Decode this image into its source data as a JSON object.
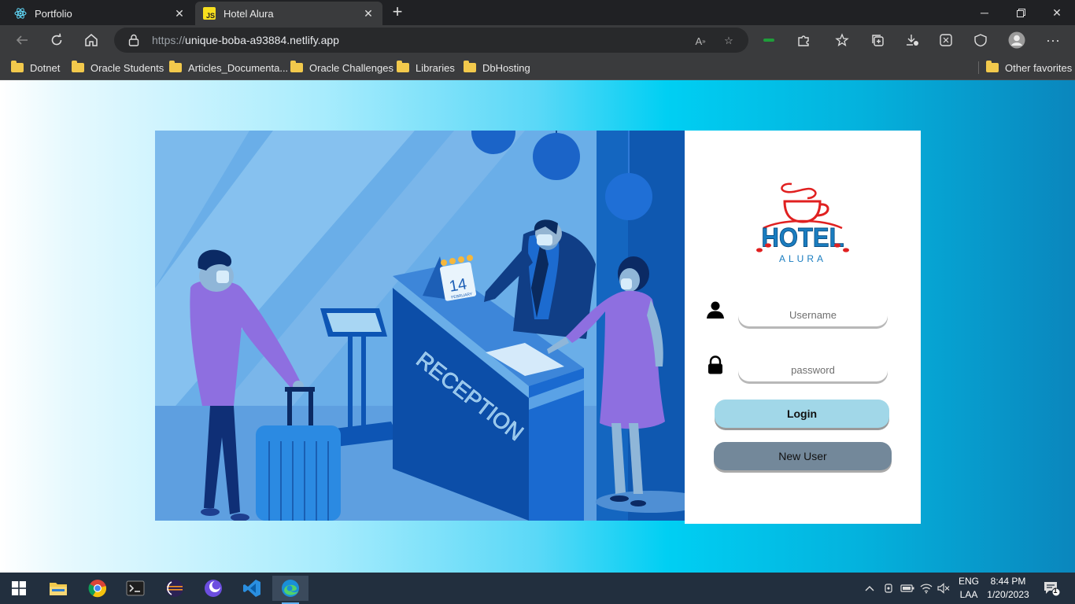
{
  "browser": {
    "tabs": [
      {
        "title": "Portfolio",
        "icon": "react-icon"
      },
      {
        "title": "Hotel Alura",
        "icon": "js-icon",
        "icon_text": "JS"
      }
    ],
    "url_prefix": "https://",
    "url_host": "unique-boba-a93884.netlify.app"
  },
  "bookmarks": [
    "Dotnet",
    "Oracle Students",
    "Articles_Documenta...",
    "Oracle Challenges",
    "Libraries",
    "DbHosting"
  ],
  "other_favorites": "Other favorites",
  "hero": {
    "sign_text": "RECEPTION",
    "calendar_day": "14",
    "calendar_month": "FEBRUARY"
  },
  "login": {
    "logo_line1": "HOTEL",
    "logo_line2": "ALURA",
    "username_placeholder": "Username",
    "password_placeholder": "password",
    "login_label": "Login",
    "new_user_label": "New User"
  },
  "taskbar": {
    "language": "ENG",
    "layout": "LAA",
    "time": "8:44 PM",
    "date": "1/20/2023",
    "notification_count": "1"
  },
  "colors": {
    "page_gradient_start": "#ffffff",
    "page_gradient_mid": "#00cff3",
    "page_gradient_end": "#0a86bd",
    "login_button": "#a1d7e8",
    "new_user_button": "#73889a",
    "logo_red": "#e02020",
    "logo_blue": "#1a7dc0"
  }
}
